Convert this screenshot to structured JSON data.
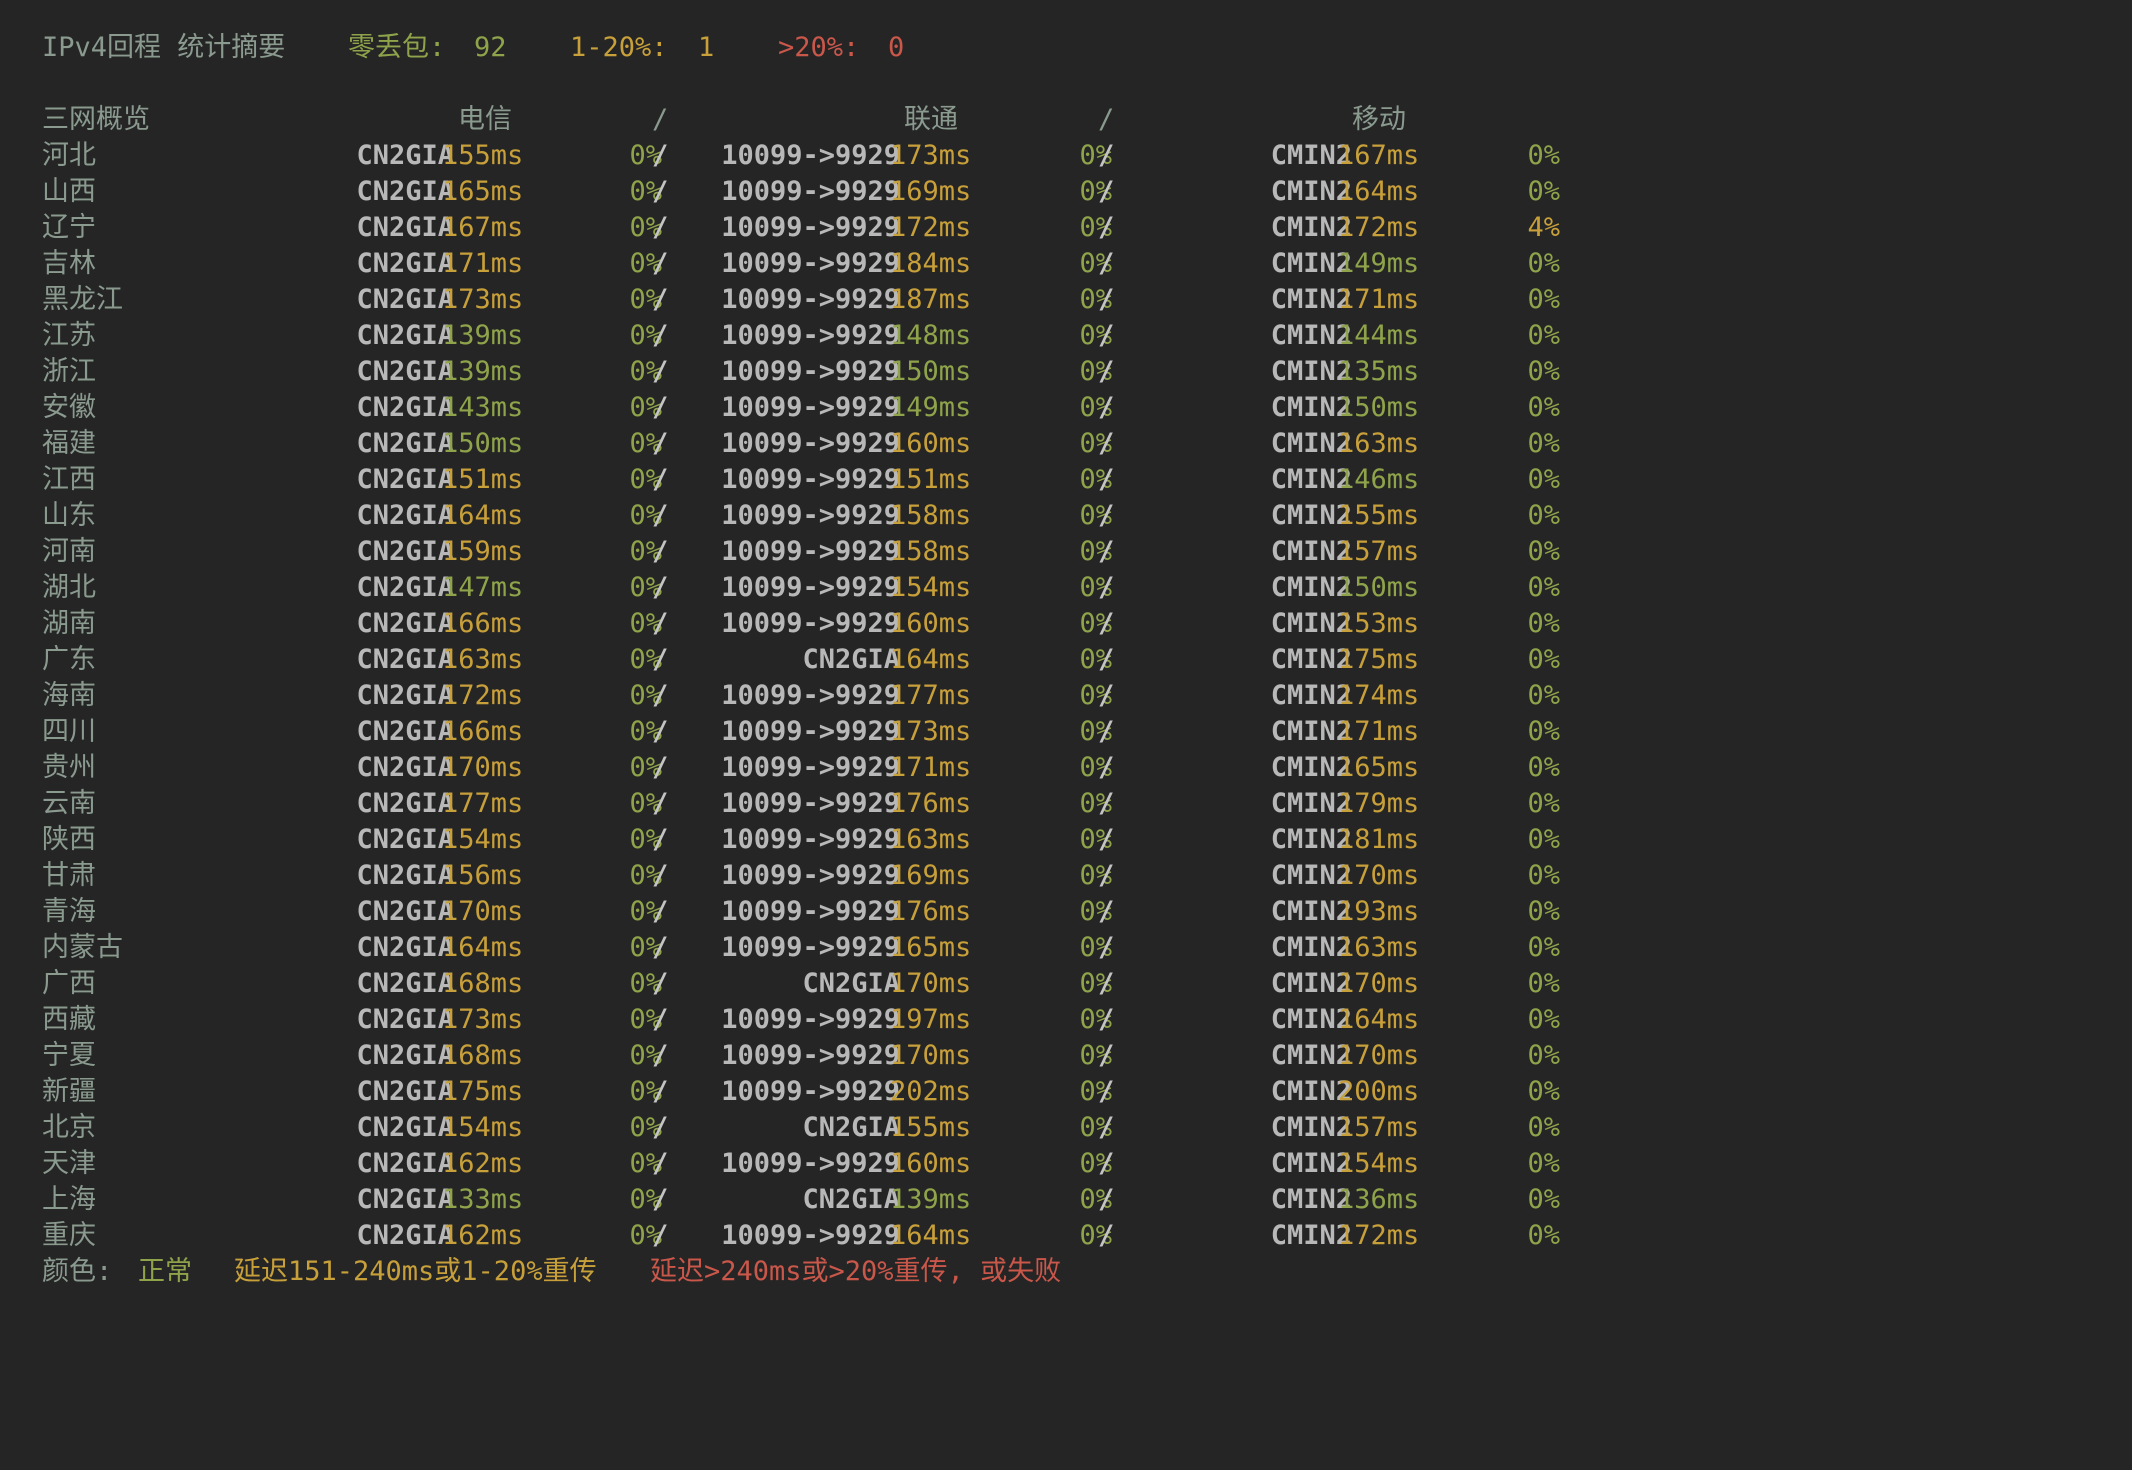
{
  "summary": {
    "title": "IPv4回程 统计摘要",
    "zero_loss_label": "零丢包:",
    "zero_loss_value": "92",
    "mid_loss_label": "1-20%:",
    "mid_loss_value": "1",
    "high_loss_label": ">20%:",
    "high_loss_value": "0"
  },
  "header": {
    "overview": "三网概览",
    "telecom": "电信",
    "unicom": "联通",
    "mobile": "移动",
    "separator": "/"
  },
  "colors": {
    "normal": "#8fa44a",
    "warning": "#c8a03a",
    "bad": "#c9574a"
  },
  "rows": [
    {
      "province": "河北",
      "ct_route": "CN2GIA",
      "ct_lat": "155ms",
      "ct_lat_c": "yellow",
      "ct_loss": "0%",
      "ct_loss_c": "green",
      "cu_route": "10099->9929",
      "cu_lat": "173ms",
      "cu_lat_c": "yellow",
      "cu_loss": "0%",
      "cu_loss_c": "green",
      "cm_route": "CMIN2",
      "cm_lat": "167ms",
      "cm_lat_c": "yellow",
      "cm_loss": "0%",
      "cm_loss_c": "green"
    },
    {
      "province": "山西",
      "ct_route": "CN2GIA",
      "ct_lat": "165ms",
      "ct_lat_c": "yellow",
      "ct_loss": "0%",
      "ct_loss_c": "green",
      "cu_route": "10099->9929",
      "cu_lat": "169ms",
      "cu_lat_c": "yellow",
      "cu_loss": "0%",
      "cu_loss_c": "green",
      "cm_route": "CMIN2",
      "cm_lat": "164ms",
      "cm_lat_c": "yellow",
      "cm_loss": "0%",
      "cm_loss_c": "green"
    },
    {
      "province": "辽宁",
      "ct_route": "CN2GIA",
      "ct_lat": "167ms",
      "ct_lat_c": "yellow",
      "ct_loss": "0%",
      "ct_loss_c": "green",
      "cu_route": "10099->9929",
      "cu_lat": "172ms",
      "cu_lat_c": "yellow",
      "cu_loss": "0%",
      "cu_loss_c": "green",
      "cm_route": "CMIN2",
      "cm_lat": "172ms",
      "cm_lat_c": "yellow",
      "cm_loss": "4%",
      "cm_loss_c": "yellow"
    },
    {
      "province": "吉林",
      "ct_route": "CN2GIA",
      "ct_lat": "171ms",
      "ct_lat_c": "yellow",
      "ct_loss": "0%",
      "ct_loss_c": "green",
      "cu_route": "10099->9929",
      "cu_lat": "184ms",
      "cu_lat_c": "yellow",
      "cu_loss": "0%",
      "cu_loss_c": "green",
      "cm_route": "CMIN2",
      "cm_lat": "149ms",
      "cm_lat_c": "green",
      "cm_loss": "0%",
      "cm_loss_c": "green"
    },
    {
      "province": "黑龙江",
      "ct_route": "CN2GIA",
      "ct_lat": "173ms",
      "ct_lat_c": "yellow",
      "ct_loss": "0%",
      "ct_loss_c": "green",
      "cu_route": "10099->9929",
      "cu_lat": "187ms",
      "cu_lat_c": "yellow",
      "cu_loss": "0%",
      "cu_loss_c": "green",
      "cm_route": "CMIN2",
      "cm_lat": "171ms",
      "cm_lat_c": "yellow",
      "cm_loss": "0%",
      "cm_loss_c": "green"
    },
    {
      "province": "江苏",
      "ct_route": "CN2GIA",
      "ct_lat": "139ms",
      "ct_lat_c": "green",
      "ct_loss": "0%",
      "ct_loss_c": "green",
      "cu_route": "10099->9929",
      "cu_lat": "148ms",
      "cu_lat_c": "green",
      "cu_loss": "0%",
      "cu_loss_c": "green",
      "cm_route": "CMIN2",
      "cm_lat": "144ms",
      "cm_lat_c": "green",
      "cm_loss": "0%",
      "cm_loss_c": "green"
    },
    {
      "province": "浙江",
      "ct_route": "CN2GIA",
      "ct_lat": "139ms",
      "ct_lat_c": "green",
      "ct_loss": "0%",
      "ct_loss_c": "green",
      "cu_route": "10099->9929",
      "cu_lat": "150ms",
      "cu_lat_c": "green",
      "cu_loss": "0%",
      "cu_loss_c": "green",
      "cm_route": "CMIN2",
      "cm_lat": "135ms",
      "cm_lat_c": "green",
      "cm_loss": "0%",
      "cm_loss_c": "green"
    },
    {
      "province": "安徽",
      "ct_route": "CN2GIA",
      "ct_lat": "143ms",
      "ct_lat_c": "green",
      "ct_loss": "0%",
      "ct_loss_c": "green",
      "cu_route": "10099->9929",
      "cu_lat": "149ms",
      "cu_lat_c": "green",
      "cu_loss": "0%",
      "cu_loss_c": "green",
      "cm_route": "CMIN2",
      "cm_lat": "150ms",
      "cm_lat_c": "green",
      "cm_loss": "0%",
      "cm_loss_c": "green"
    },
    {
      "province": "福建",
      "ct_route": "CN2GIA",
      "ct_lat": "150ms",
      "ct_lat_c": "green",
      "ct_loss": "0%",
      "ct_loss_c": "green",
      "cu_route": "10099->9929",
      "cu_lat": "160ms",
      "cu_lat_c": "yellow",
      "cu_loss": "0%",
      "cu_loss_c": "green",
      "cm_route": "CMIN2",
      "cm_lat": "163ms",
      "cm_lat_c": "yellow",
      "cm_loss": "0%",
      "cm_loss_c": "green"
    },
    {
      "province": "江西",
      "ct_route": "CN2GIA",
      "ct_lat": "151ms",
      "ct_lat_c": "yellow",
      "ct_loss": "0%",
      "ct_loss_c": "green",
      "cu_route": "10099->9929",
      "cu_lat": "151ms",
      "cu_lat_c": "yellow",
      "cu_loss": "0%",
      "cu_loss_c": "green",
      "cm_route": "CMIN2",
      "cm_lat": "146ms",
      "cm_lat_c": "green",
      "cm_loss": "0%",
      "cm_loss_c": "green"
    },
    {
      "province": "山东",
      "ct_route": "CN2GIA",
      "ct_lat": "164ms",
      "ct_lat_c": "yellow",
      "ct_loss": "0%",
      "ct_loss_c": "green",
      "cu_route": "10099->9929",
      "cu_lat": "158ms",
      "cu_lat_c": "yellow",
      "cu_loss": "0%",
      "cu_loss_c": "green",
      "cm_route": "CMIN2",
      "cm_lat": "155ms",
      "cm_lat_c": "yellow",
      "cm_loss": "0%",
      "cm_loss_c": "green"
    },
    {
      "province": "河南",
      "ct_route": "CN2GIA",
      "ct_lat": "159ms",
      "ct_lat_c": "yellow",
      "ct_loss": "0%",
      "ct_loss_c": "green",
      "cu_route": "10099->9929",
      "cu_lat": "158ms",
      "cu_lat_c": "yellow",
      "cu_loss": "0%",
      "cu_loss_c": "green",
      "cm_route": "CMIN2",
      "cm_lat": "157ms",
      "cm_lat_c": "yellow",
      "cm_loss": "0%",
      "cm_loss_c": "green"
    },
    {
      "province": "湖北",
      "ct_route": "CN2GIA",
      "ct_lat": "147ms",
      "ct_lat_c": "green",
      "ct_loss": "0%",
      "ct_loss_c": "green",
      "cu_route": "10099->9929",
      "cu_lat": "154ms",
      "cu_lat_c": "yellow",
      "cu_loss": "0%",
      "cu_loss_c": "green",
      "cm_route": "CMIN2",
      "cm_lat": "150ms",
      "cm_lat_c": "green",
      "cm_loss": "0%",
      "cm_loss_c": "green"
    },
    {
      "province": "湖南",
      "ct_route": "CN2GIA",
      "ct_lat": "166ms",
      "ct_lat_c": "yellow",
      "ct_loss": "0%",
      "ct_loss_c": "green",
      "cu_route": "10099->9929",
      "cu_lat": "160ms",
      "cu_lat_c": "yellow",
      "cu_loss": "0%",
      "cu_loss_c": "green",
      "cm_route": "CMIN2",
      "cm_lat": "153ms",
      "cm_lat_c": "yellow",
      "cm_loss": "0%",
      "cm_loss_c": "green"
    },
    {
      "province": "广东",
      "ct_route": "CN2GIA",
      "ct_lat": "163ms",
      "ct_lat_c": "yellow",
      "ct_loss": "0%",
      "ct_loss_c": "green",
      "cu_route": "CN2GIA",
      "cu_lat": "164ms",
      "cu_lat_c": "yellow",
      "cu_loss": "0%",
      "cu_loss_c": "green",
      "cm_route": "CMIN2",
      "cm_lat": "175ms",
      "cm_lat_c": "yellow",
      "cm_loss": "0%",
      "cm_loss_c": "green"
    },
    {
      "province": "海南",
      "ct_route": "CN2GIA",
      "ct_lat": "172ms",
      "ct_lat_c": "yellow",
      "ct_loss": "0%",
      "ct_loss_c": "green",
      "cu_route": "10099->9929",
      "cu_lat": "177ms",
      "cu_lat_c": "yellow",
      "cu_loss": "0%",
      "cu_loss_c": "green",
      "cm_route": "CMIN2",
      "cm_lat": "174ms",
      "cm_lat_c": "yellow",
      "cm_loss": "0%",
      "cm_loss_c": "green"
    },
    {
      "province": "四川",
      "ct_route": "CN2GIA",
      "ct_lat": "166ms",
      "ct_lat_c": "yellow",
      "ct_loss": "0%",
      "ct_loss_c": "green",
      "cu_route": "10099->9929",
      "cu_lat": "173ms",
      "cu_lat_c": "yellow",
      "cu_loss": "0%",
      "cu_loss_c": "green",
      "cm_route": "CMIN2",
      "cm_lat": "171ms",
      "cm_lat_c": "yellow",
      "cm_loss": "0%",
      "cm_loss_c": "green"
    },
    {
      "province": "贵州",
      "ct_route": "CN2GIA",
      "ct_lat": "170ms",
      "ct_lat_c": "yellow",
      "ct_loss": "0%",
      "ct_loss_c": "green",
      "cu_route": "10099->9929",
      "cu_lat": "171ms",
      "cu_lat_c": "yellow",
      "cu_loss": "0%",
      "cu_loss_c": "green",
      "cm_route": "CMIN2",
      "cm_lat": "165ms",
      "cm_lat_c": "yellow",
      "cm_loss": "0%",
      "cm_loss_c": "green"
    },
    {
      "province": "云南",
      "ct_route": "CN2GIA",
      "ct_lat": "177ms",
      "ct_lat_c": "yellow",
      "ct_loss": "0%",
      "ct_loss_c": "green",
      "cu_route": "10099->9929",
      "cu_lat": "176ms",
      "cu_lat_c": "yellow",
      "cu_loss": "0%",
      "cu_loss_c": "green",
      "cm_route": "CMIN2",
      "cm_lat": "179ms",
      "cm_lat_c": "yellow",
      "cm_loss": "0%",
      "cm_loss_c": "green"
    },
    {
      "province": "陕西",
      "ct_route": "CN2GIA",
      "ct_lat": "154ms",
      "ct_lat_c": "yellow",
      "ct_loss": "0%",
      "ct_loss_c": "green",
      "cu_route": "10099->9929",
      "cu_lat": "163ms",
      "cu_lat_c": "yellow",
      "cu_loss": "0%",
      "cu_loss_c": "green",
      "cm_route": "CMIN2",
      "cm_lat": "181ms",
      "cm_lat_c": "yellow",
      "cm_loss": "0%",
      "cm_loss_c": "green"
    },
    {
      "province": "甘肃",
      "ct_route": "CN2GIA",
      "ct_lat": "156ms",
      "ct_lat_c": "yellow",
      "ct_loss": "0%",
      "ct_loss_c": "green",
      "cu_route": "10099->9929",
      "cu_lat": "169ms",
      "cu_lat_c": "yellow",
      "cu_loss": "0%",
      "cu_loss_c": "green",
      "cm_route": "CMIN2",
      "cm_lat": "170ms",
      "cm_lat_c": "yellow",
      "cm_loss": "0%",
      "cm_loss_c": "green"
    },
    {
      "province": "青海",
      "ct_route": "CN2GIA",
      "ct_lat": "170ms",
      "ct_lat_c": "yellow",
      "ct_loss": "0%",
      "ct_loss_c": "green",
      "cu_route": "10099->9929",
      "cu_lat": "176ms",
      "cu_lat_c": "yellow",
      "cu_loss": "0%",
      "cu_loss_c": "green",
      "cm_route": "CMIN2",
      "cm_lat": "193ms",
      "cm_lat_c": "yellow",
      "cm_loss": "0%",
      "cm_loss_c": "green"
    },
    {
      "province": "内蒙古",
      "ct_route": "CN2GIA",
      "ct_lat": "164ms",
      "ct_lat_c": "yellow",
      "ct_loss": "0%",
      "ct_loss_c": "green",
      "cu_route": "10099->9929",
      "cu_lat": "165ms",
      "cu_lat_c": "yellow",
      "cu_loss": "0%",
      "cu_loss_c": "green",
      "cm_route": "CMIN2",
      "cm_lat": "163ms",
      "cm_lat_c": "yellow",
      "cm_loss": "0%",
      "cm_loss_c": "green"
    },
    {
      "province": "广西",
      "ct_route": "CN2GIA",
      "ct_lat": "168ms",
      "ct_lat_c": "yellow",
      "ct_loss": "0%",
      "ct_loss_c": "green",
      "cu_route": "CN2GIA",
      "cu_lat": "170ms",
      "cu_lat_c": "yellow",
      "cu_loss": "0%",
      "cu_loss_c": "green",
      "cm_route": "CMIN2",
      "cm_lat": "170ms",
      "cm_lat_c": "yellow",
      "cm_loss": "0%",
      "cm_loss_c": "green"
    },
    {
      "province": "西藏",
      "ct_route": "CN2GIA",
      "ct_lat": "173ms",
      "ct_lat_c": "yellow",
      "ct_loss": "0%",
      "ct_loss_c": "green",
      "cu_route": "10099->9929",
      "cu_lat": "197ms",
      "cu_lat_c": "yellow",
      "cu_loss": "0%",
      "cu_loss_c": "green",
      "cm_route": "CMIN2",
      "cm_lat": "164ms",
      "cm_lat_c": "yellow",
      "cm_loss": "0%",
      "cm_loss_c": "green"
    },
    {
      "province": "宁夏",
      "ct_route": "CN2GIA",
      "ct_lat": "168ms",
      "ct_lat_c": "yellow",
      "ct_loss": "0%",
      "ct_loss_c": "green",
      "cu_route": "10099->9929",
      "cu_lat": "170ms",
      "cu_lat_c": "yellow",
      "cu_loss": "0%",
      "cu_loss_c": "green",
      "cm_route": "CMIN2",
      "cm_lat": "170ms",
      "cm_lat_c": "yellow",
      "cm_loss": "0%",
      "cm_loss_c": "green"
    },
    {
      "province": "新疆",
      "ct_route": "CN2GIA",
      "ct_lat": "175ms",
      "ct_lat_c": "yellow",
      "ct_loss": "0%",
      "ct_loss_c": "green",
      "cu_route": "10099->9929",
      "cu_lat": "202ms",
      "cu_lat_c": "yellow",
      "cu_loss": "0%",
      "cu_loss_c": "green",
      "cm_route": "CMIN2",
      "cm_lat": "200ms",
      "cm_lat_c": "yellow",
      "cm_loss": "0%",
      "cm_loss_c": "green"
    },
    {
      "province": "北京",
      "ct_route": "CN2GIA",
      "ct_lat": "154ms",
      "ct_lat_c": "yellow",
      "ct_loss": "0%",
      "ct_loss_c": "green",
      "cu_route": "CN2GIA",
      "cu_lat": "155ms",
      "cu_lat_c": "yellow",
      "cu_loss": "0%",
      "cu_loss_c": "green",
      "cm_route": "CMIN2",
      "cm_lat": "157ms",
      "cm_lat_c": "yellow",
      "cm_loss": "0%",
      "cm_loss_c": "green"
    },
    {
      "province": "天津",
      "ct_route": "CN2GIA",
      "ct_lat": "162ms",
      "ct_lat_c": "yellow",
      "ct_loss": "0%",
      "ct_loss_c": "green",
      "cu_route": "10099->9929",
      "cu_lat": "160ms",
      "cu_lat_c": "yellow",
      "cu_loss": "0%",
      "cu_loss_c": "green",
      "cm_route": "CMIN2",
      "cm_lat": "154ms",
      "cm_lat_c": "yellow",
      "cm_loss": "0%",
      "cm_loss_c": "green"
    },
    {
      "province": "上海",
      "ct_route": "CN2GIA",
      "ct_lat": "133ms",
      "ct_lat_c": "green",
      "ct_loss": "0%",
      "ct_loss_c": "green",
      "cu_route": "CN2GIA",
      "cu_lat": "139ms",
      "cu_lat_c": "green",
      "cu_loss": "0%",
      "cu_loss_c": "green",
      "cm_route": "CMIN2",
      "cm_lat": "136ms",
      "cm_lat_c": "green",
      "cm_loss": "0%",
      "cm_loss_c": "green"
    },
    {
      "province": "重庆",
      "ct_route": "CN2GIA",
      "ct_lat": "162ms",
      "ct_lat_c": "yellow",
      "ct_loss": "0%",
      "ct_loss_c": "green",
      "cu_route": "10099->9929",
      "cu_lat": "164ms",
      "cu_lat_c": "yellow",
      "cu_loss": "0%",
      "cu_loss_c": "green",
      "cm_route": "CMIN2",
      "cm_lat": "172ms",
      "cm_lat_c": "yellow",
      "cm_loss": "0%",
      "cm_loss_c": "green"
    }
  ],
  "legend": {
    "prefix": "颜色:",
    "normal": "正常",
    "warning": "延迟151-240ms或1-20%重传",
    "bad": "延迟>240ms或>20%重传, 或失败"
  }
}
